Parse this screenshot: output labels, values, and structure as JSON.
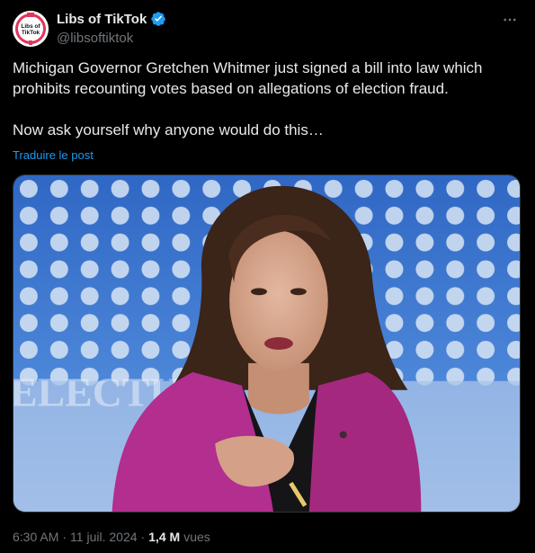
{
  "account": {
    "display_name": "Libs of TikTok",
    "handle": "@libsoftiktok",
    "avatar_text_line1": "Libs of",
    "avatar_text_line2": "TikTok",
    "avatar_icon": "libs-of-tiktok-logo-icon",
    "verified_icon": "verified-badge-icon",
    "verified_color": "#1d9bf0"
  },
  "more_icon": "more-options-icon",
  "tweet": {
    "paragraph_1": "Michigan Governor Gretchen Whitmer just signed a bill into law which prohibits recounting votes based on allegations of election fraud.",
    "paragraph_2": "Now ask yourself why anyone would do this…",
    "translate_label": "Traduire le post"
  },
  "media": {
    "type": "photo",
    "background_text": "ELECTU"
  },
  "meta": {
    "time": "6:30 AM",
    "separator_1": "·",
    "date": "11 juil. 2024",
    "separator_2": "·",
    "views_count": "1,4 M",
    "views_label": "vues"
  },
  "colors": {
    "background": "#000000",
    "text_primary": "#e7e9ea",
    "text_secondary": "#71767b",
    "link": "#1d9bf0",
    "blazer": "#b22e8f"
  }
}
